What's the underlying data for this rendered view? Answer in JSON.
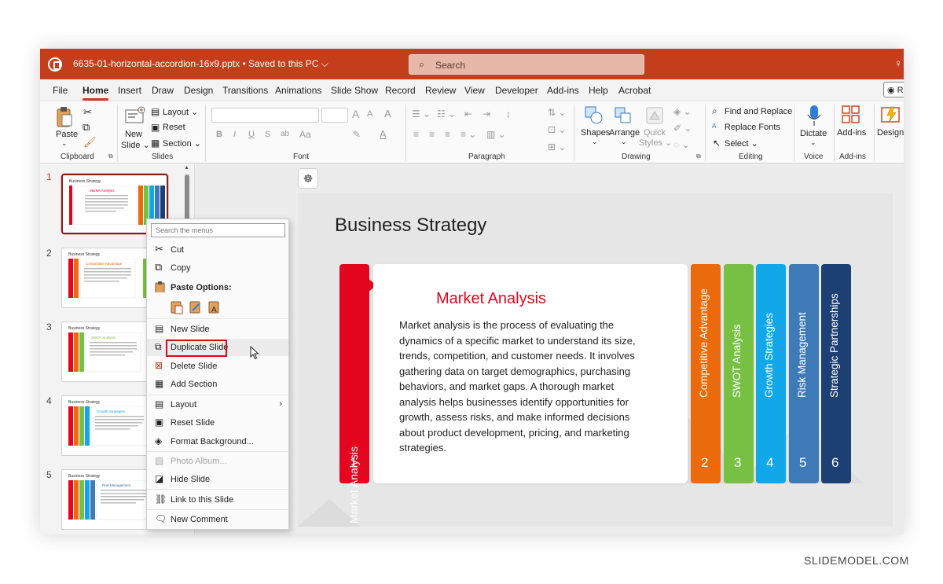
{
  "window": {
    "doc_title": "6635-01-horizontal-accordion-16x9.pptx • Saved to this PC ⌵",
    "search_placeholder": "Search"
  },
  "menu_tabs": [
    "File",
    "Home",
    "Insert",
    "Draw",
    "Design",
    "Transitions",
    "Animations",
    "Slide Show",
    "Record",
    "Review",
    "View",
    "Developer",
    "Add-ins",
    "Help",
    "Acrobat"
  ],
  "record_label": "Re",
  "ribbon": {
    "clipboard": {
      "paste": "Paste",
      "group": "Clipboard"
    },
    "slides": {
      "new_slide": "New",
      "new_slide2": "Slide ⌄",
      "layout": "Layout ⌄",
      "reset": "Reset",
      "section": "Section ⌄",
      "group": "Slides"
    },
    "font": {
      "group": "Font",
      "bold": "B",
      "italic": "I",
      "underline": "U",
      "strike": "S",
      "spacing": "ab",
      "grow": "A",
      "shrink": "A",
      "clear": "A"
    },
    "paragraph": {
      "group": "Paragraph"
    },
    "drawing": {
      "shapes": "Shapes",
      "arrange": "Arrange",
      "quick_styles": "Quick",
      "quick_styles2": "Styles ⌄",
      "group": "Drawing"
    },
    "editing": {
      "find_replace": "Find and Replace",
      "replace_fonts": "Replace Fonts",
      "select": "Select ⌄",
      "group": "Editing"
    },
    "voice": {
      "dictate": "Dictate",
      "group": "Voice"
    },
    "addins": {
      "addins": "Add-ins",
      "group": "Add-ins"
    },
    "designer": {
      "label": "Designe"
    }
  },
  "thumbnails": [
    {
      "num": "1",
      "title": "Business Strategy",
      "heading": "Market Analysis",
      "heading_color": "#e3061e"
    },
    {
      "num": "2",
      "title": "Business Strategy",
      "heading": "Competitive Advantage",
      "heading_color": "#ea6a0c"
    },
    {
      "num": "3",
      "title": "Business Strategy",
      "heading": "SWOT Analysis",
      "heading_color": "#6cb43a"
    },
    {
      "num": "4",
      "title": "Business Strategy",
      "heading": "Growth Strategies",
      "heading_color": "#1a9ed9"
    },
    {
      "num": "5",
      "title": "Business Strategy",
      "heading": "Risk Management",
      "heading_color": "#3c6ea8"
    }
  ],
  "context_menu": {
    "search_placeholder": "Search the menus",
    "cut": "Cut",
    "copy": "Copy",
    "paste_options": "Paste Options:",
    "new_slide": "New Slide",
    "duplicate_slide": "Duplicate Slide",
    "delete_slide": "Delete Slide",
    "add_section": "Add Section",
    "layout": "Layout",
    "reset_slide": "Reset Slide",
    "format_background": "Format Background...",
    "photo_album": "Photo Album...",
    "hide_slide": "Hide Slide",
    "link_to_slide": "Link to this Slide",
    "new_comment": "New Comment"
  },
  "slide": {
    "title": "Business Strategy",
    "main_tab": {
      "label": "Market Analysis",
      "number": "1",
      "color": "#e3061e"
    },
    "heading": "Market Analysis",
    "body": "Market analysis is the process of evaluating the dynamics of a specific market to understand its size, trends, competition, and customer needs. It involves gathering data on target demographics, purchasing behaviors, and market gaps. A thorough market analysis helps businesses identify opportunities for growth, assess risks, and make informed decisions about product development, pricing, and marketing strategies.",
    "side_tabs": [
      {
        "label": "Competitive Advantage",
        "number": "2",
        "color": "#ea6a0c"
      },
      {
        "label": "SWOT Analysis",
        "number": "3",
        "color": "#78c043"
      },
      {
        "label": "Growth Strategies",
        "number": "4",
        "color": "#12a7e8"
      },
      {
        "label": "Risk Management",
        "number": "5",
        "color": "#3f7ab8"
      },
      {
        "label": "Strategic Partnerships",
        "number": "6",
        "color": "#1c3f74"
      }
    ]
  },
  "watermark": "SLIDEMODEL.COM"
}
